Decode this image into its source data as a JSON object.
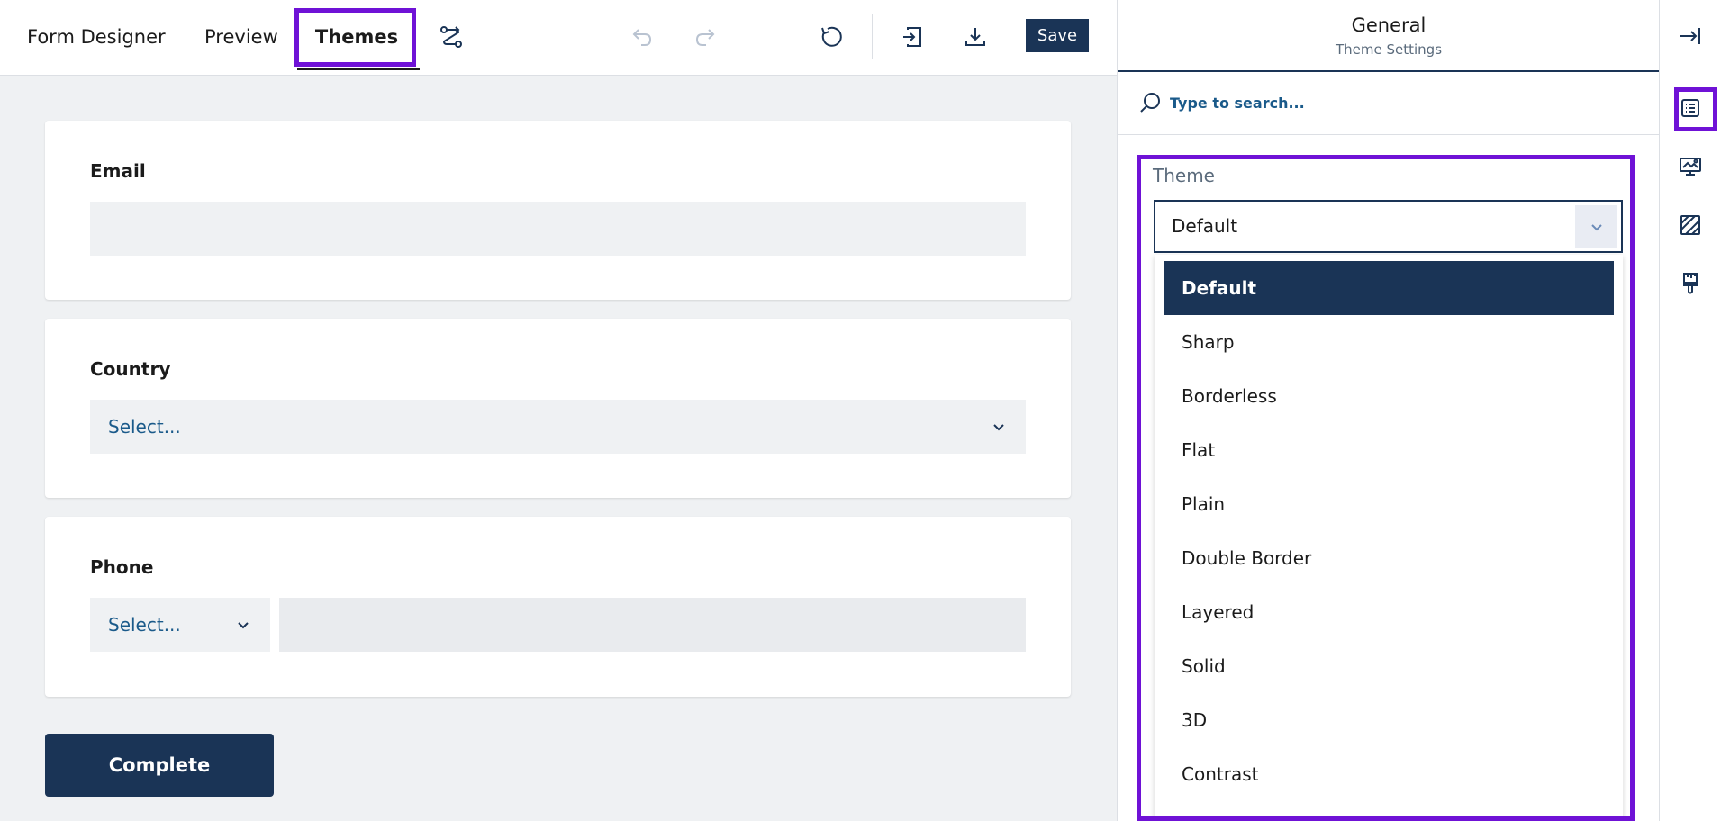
{
  "toolbar": {
    "tabs": [
      {
        "label": "Form Designer"
      },
      {
        "label": "Preview"
      },
      {
        "label": "Themes"
      }
    ],
    "save_label": "Save",
    "icons": [
      "logic-icon",
      "undo-icon",
      "redo-icon",
      "reset-icon",
      "import-icon",
      "download-icon"
    ]
  },
  "form": {
    "questions": [
      {
        "title": "Email",
        "type": "text"
      },
      {
        "title": "Country",
        "type": "dropdown",
        "placeholder": "Select..."
      },
      {
        "title": "Phone",
        "type": "phone",
        "placeholder": "Select..."
      }
    ],
    "complete_label": "Complete"
  },
  "panel": {
    "title": "General",
    "subtitle": "Theme Settings",
    "search_placeholder": "Type to search...",
    "theme_label": "Theme",
    "theme_value": "Default",
    "theme_options": [
      {
        "label": "Default",
        "selected": true
      },
      {
        "label": "Sharp"
      },
      {
        "label": "Borderless"
      },
      {
        "label": "Flat"
      },
      {
        "label": "Plain"
      },
      {
        "label": "Double Border"
      },
      {
        "label": "Layered"
      },
      {
        "label": "Solid"
      },
      {
        "label": "3D"
      },
      {
        "label": "Contrast"
      }
    ]
  },
  "iconbar": {
    "icons": [
      "collapse-panel-icon",
      "general-settings-icon",
      "appearance-icon",
      "background-icon",
      "brush-icon"
    ]
  },
  "colors": {
    "accent": "#1a3456",
    "highlight": "#6f12d6",
    "canvas": "#eff1f3",
    "link": "#1a5a8a"
  }
}
